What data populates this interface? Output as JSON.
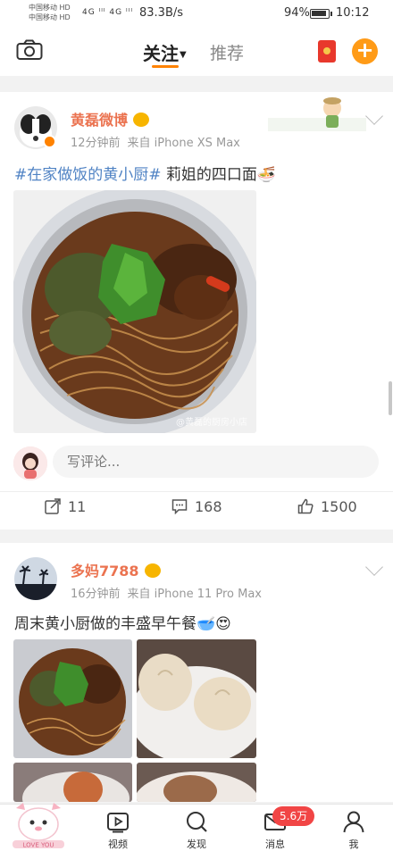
{
  "status_bar": {
    "carrier1": "中国移动 HD",
    "carrier2": "中国移动 HD",
    "signal": "4G ᴵᴵᴵ 4G ᴵᴵᴵ",
    "speed": "83.3B/s",
    "battery": "94%",
    "time": "10:12"
  },
  "top_nav": {
    "tab_follow": "关注",
    "tab_recommend": "推荐"
  },
  "posts": [
    {
      "author": "黄磊微博",
      "time": "12分钟前",
      "source": "来自 iPhone XS Max",
      "hashtag": "#在家做饭的黄小厨#",
      "text": " 莉姐的四口面",
      "emoji": "🍜",
      "image_alt": "bowl of noodles with greens and pickled vegetables",
      "watermark": "@黄磊的厨房小店",
      "comment_placeholder": "写评论...",
      "repost_count": "11",
      "comment_count": "168",
      "like_count": "1500"
    },
    {
      "author": "多妈7788",
      "time": "16分钟前",
      "source": "来自 iPhone 11 Pro Max",
      "text": "周末黄小厨做的丰盛早午餐",
      "emoji": "🥣😍"
    }
  ],
  "tab_bar": {
    "items": [
      {
        "label": "",
        "icon": "mascot-icon"
      },
      {
        "label": "视频",
        "icon": "video-icon"
      },
      {
        "label": "发现",
        "icon": "search-icon"
      },
      {
        "label": "消息",
        "icon": "mail-icon"
      },
      {
        "label": "我",
        "icon": "person-icon"
      }
    ],
    "message_badge": "5.6万"
  },
  "colors": {
    "accent": "#ff8200",
    "name": "#eb7350",
    "hashtag": "#5083c4",
    "badge": "#f14545"
  }
}
